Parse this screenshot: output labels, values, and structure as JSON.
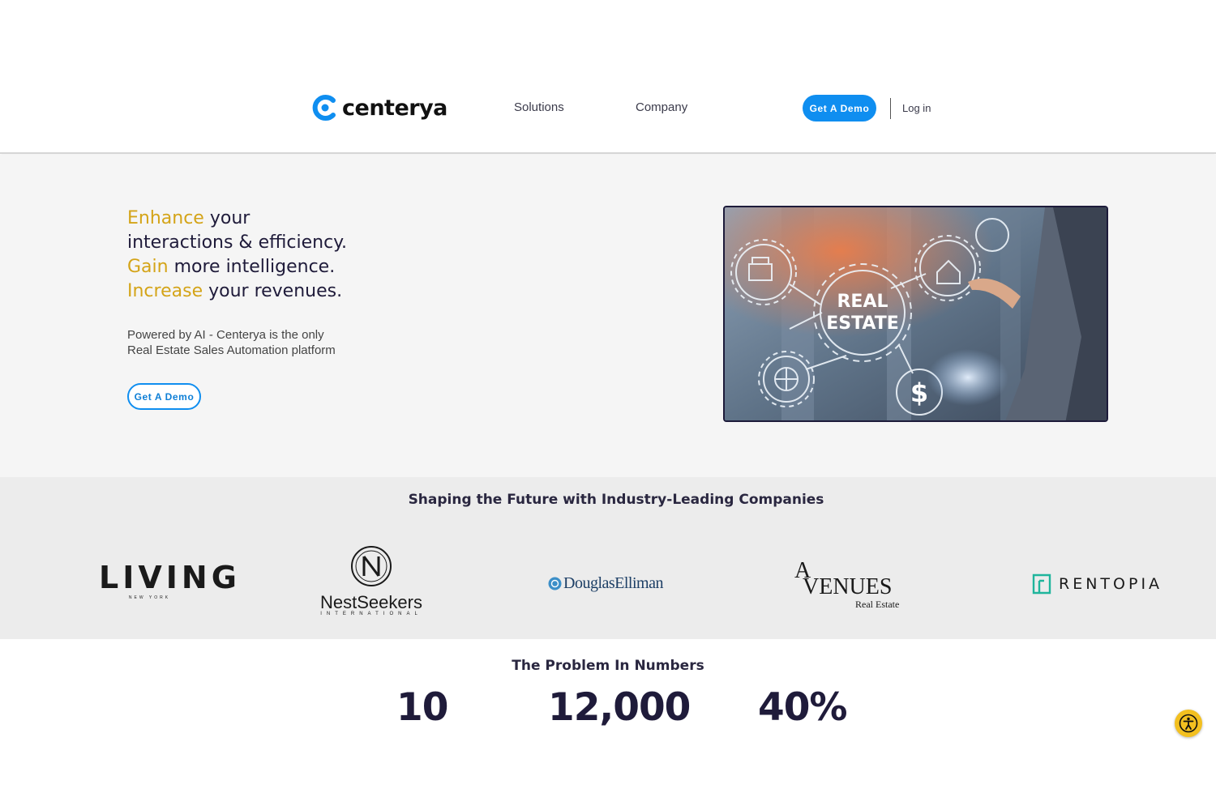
{
  "header": {
    "logo_text": "centerya",
    "nav": [
      "Solutions",
      "Company"
    ],
    "demo_button": "Get A Demo",
    "login": "Log in"
  },
  "hero": {
    "line1_highlight": "Enhance",
    "line1_rest": " your",
    "line2": "interactions & efficiency.",
    "line3_highlight": "Gain",
    "line3_rest": " more intelligence.",
    "line4_highlight": "Increase",
    "line4_rest": " your revenues.",
    "subtitle_line1": "Powered by AI - Centerya is the only",
    "subtitle_line2": "Real Estate Sales Automation platform",
    "demo_button": "Get A Demo",
    "image_text_1": "REAL",
    "image_text_2": "ESTATE"
  },
  "partners": {
    "title": "Shaping the Future with Industry-Leading Companies",
    "logos": {
      "living": "LIVING",
      "living_sub": "NEW YORK",
      "nestseekers": "NestSeekers",
      "nestseekers_sub": "INTERNATIONAL",
      "douglas": "DouglasElliman",
      "avenues_a": "A",
      "avenues": "VENUES",
      "avenues_sub": "Real Estate",
      "rentopia": "RENTOPIA"
    }
  },
  "numbers": {
    "title": "The Problem In Numbers",
    "values": [
      "10",
      "12,000",
      "40%"
    ]
  },
  "colors": {
    "brand_blue": "#0f8ef0",
    "highlight_gold": "#d4a418",
    "dark_navy": "#1f1b3a",
    "accessibility_yellow": "#f3c020"
  },
  "icons": [
    "centerya-logo-icon",
    "accessibility-icon"
  ]
}
